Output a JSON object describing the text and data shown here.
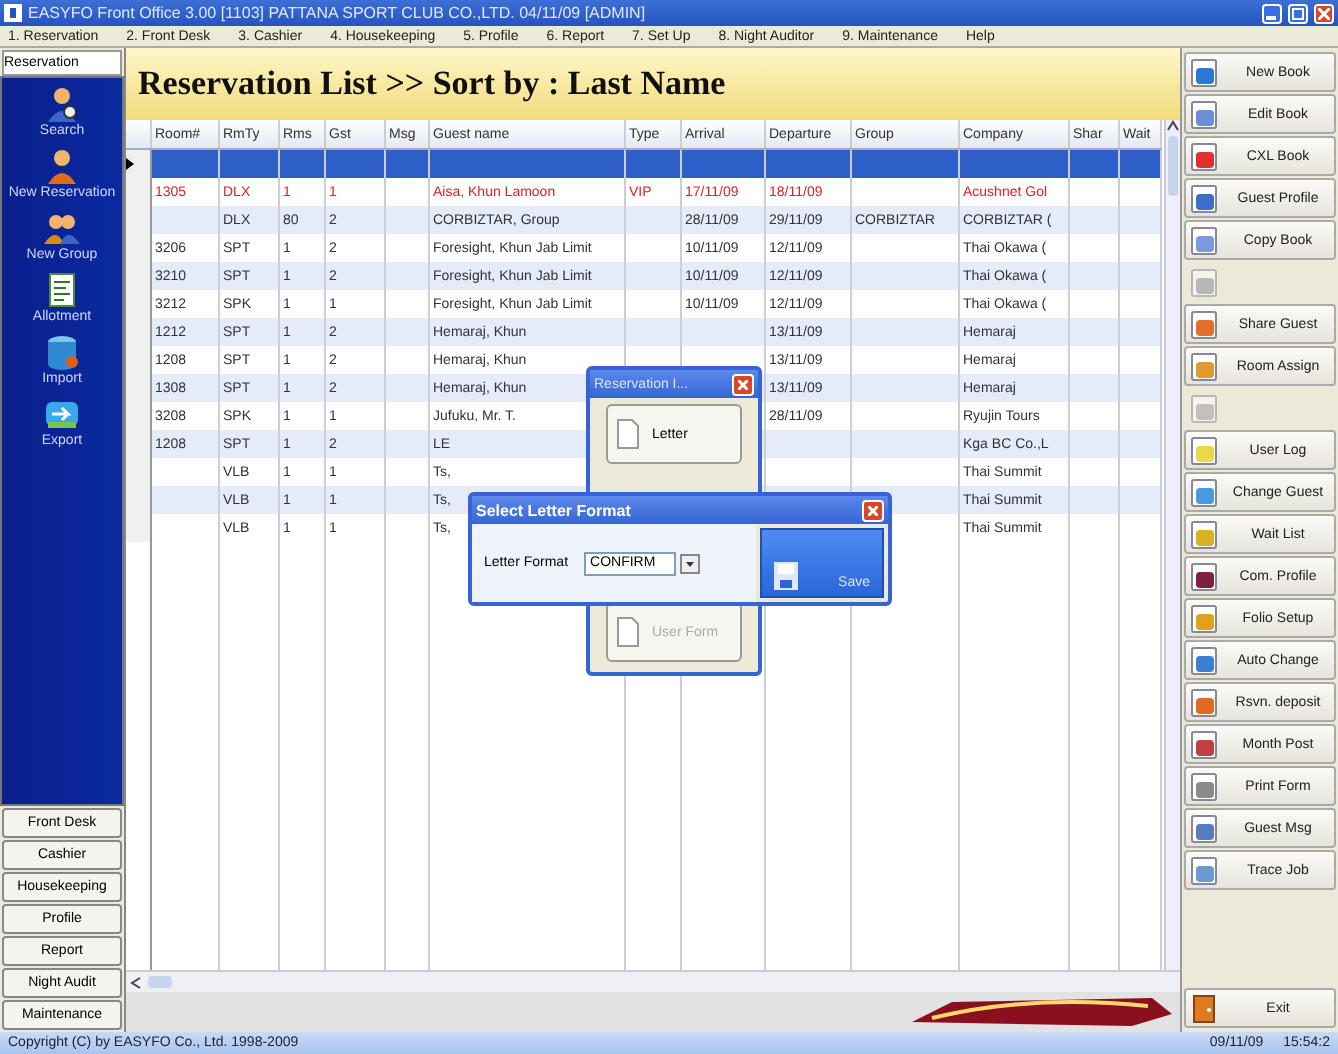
{
  "window": {
    "title": "EASYFO Front Office 3.00 [1103]   PATTANA SPORT CLUB CO.,LTD.  04/11/09 [ADMIN]"
  },
  "menu": [
    "1. Reservation",
    "2. Front Desk",
    "3. Cashier",
    "4. Housekeeping",
    "5. Profile",
    "6. Report",
    "7. Set Up",
    "8. Night Auditor",
    "9. Maintenance",
    "Help"
  ],
  "sidebar": {
    "tab": "Reservation",
    "items": [
      "Search",
      "New Reservation",
      "New Group",
      "Allotment",
      "Import",
      "Export"
    ],
    "modules": [
      "Front Desk",
      "Cashier",
      "Housekeeping",
      "Profile",
      "Report",
      "Night Audit",
      "Maintenance"
    ]
  },
  "heading": "Reservation List >> Sort by : Last Name",
  "table": {
    "columns": [
      "Room#",
      "RmTy",
      "Rms",
      "Gst",
      "Msg",
      "Guest name",
      "Type",
      "Arrival",
      "Departure",
      "Group",
      "Company",
      "Shar",
      "Wait"
    ],
    "rows": [
      {
        "selected": true,
        "alert": false,
        "cells": [
          null,
          null,
          null,
          null,
          null,
          null,
          null,
          null,
          null,
          null,
          null,
          null,
          null
        ]
      },
      {
        "selected": false,
        "alert": true,
        "cells": [
          "1305",
          "DLX",
          "1",
          "1",
          null,
          "Aisa, Khun Lamoon",
          "VIP",
          "17/11/09",
          "18/11/09",
          null,
          "Acushnet Gol",
          null,
          null
        ]
      },
      {
        "selected": false,
        "alert": false,
        "cells": [
          null,
          "DLX",
          "80",
          "2",
          null,
          "CORBIZTAR, Group",
          null,
          "28/11/09",
          "29/11/09",
          "CORBIZTAR",
          "CORBIZTAR (",
          null,
          null
        ]
      },
      {
        "selected": false,
        "alert": false,
        "cells": [
          "3206",
          "SPT",
          "1",
          "2",
          null,
          "Foresight, Khun Jab Limit",
          null,
          "10/11/09",
          "12/11/09",
          null,
          "Thai Okawa (",
          null,
          null
        ]
      },
      {
        "selected": false,
        "alert": false,
        "cells": [
          "3210",
          "SPT",
          "1",
          "2",
          null,
          "Foresight, Khun Jab Limit",
          null,
          "10/11/09",
          "12/11/09",
          null,
          "Thai Okawa (",
          null,
          null
        ]
      },
      {
        "selected": false,
        "alert": false,
        "cells": [
          "3212",
          "SPK",
          "1",
          "1",
          null,
          "Foresight, Khun Jab Limit",
          null,
          "10/11/09",
          "12/11/09",
          null,
          "Thai Okawa (",
          null,
          null
        ]
      },
      {
        "selected": false,
        "alert": false,
        "cells": [
          "1212",
          "SPT",
          "1",
          "2",
          null,
          "Hemaraj, Khun",
          null,
          null,
          "13/11/09",
          null,
          "Hemaraj",
          null,
          null
        ]
      },
      {
        "selected": false,
        "alert": false,
        "cells": [
          "1208",
          "SPT",
          "1",
          "2",
          null,
          "Hemaraj, Khun",
          null,
          null,
          "13/11/09",
          null,
          "Hemaraj",
          null,
          null
        ]
      },
      {
        "selected": false,
        "alert": false,
        "cells": [
          "1308",
          "SPT",
          "1",
          "2",
          null,
          "Hemaraj, Khun",
          null,
          null,
          "13/11/09",
          null,
          "Hemaraj",
          null,
          null
        ]
      },
      {
        "selected": false,
        "alert": false,
        "cells": [
          "3208",
          "SPK",
          "1",
          "1",
          null,
          "Jufuku, Mr. T.",
          null,
          null,
          "28/11/09",
          null,
          "Ryujin Tours",
          null,
          null
        ]
      },
      {
        "selected": false,
        "alert": false,
        "cells": [
          "1208",
          "SPT",
          "1",
          "2",
          null,
          "LE",
          null,
          null,
          null,
          null,
          "Kga BC Co.,L",
          null,
          null
        ]
      },
      {
        "selected": false,
        "alert": false,
        "cells": [
          null,
          "VLB",
          "1",
          "1",
          null,
          "Ts,",
          null,
          null,
          null,
          null,
          "Thai Summit",
          null,
          null
        ]
      },
      {
        "selected": false,
        "alert": false,
        "cells": [
          null,
          "VLB",
          "1",
          "1",
          null,
          "Ts,",
          null,
          null,
          null,
          null,
          "Thai Summit",
          null,
          null
        ]
      },
      {
        "selected": false,
        "alert": false,
        "cells": [
          null,
          "VLB",
          "1",
          "1",
          null,
          "Ts,",
          null,
          null,
          null,
          null,
          "Thai Summit",
          null,
          null
        ]
      }
    ]
  },
  "reservation_dialog": {
    "title": "Reservation I...",
    "buttons": [
      {
        "label": "Letter",
        "disabled": false
      },
      {
        "label": "User Form",
        "disabled": true
      }
    ]
  },
  "letter_dialog": {
    "title": "Select Letter Format",
    "field_label": "Letter Format",
    "value": "CONFIRM",
    "button": "Save"
  },
  "toolbar": [
    {
      "label": "New Book",
      "disabled": false
    },
    {
      "label": "Edit Book",
      "disabled": false
    },
    {
      "label": "CXL Book",
      "disabled": false
    },
    {
      "label": "Guest Profile",
      "disabled": false
    },
    {
      "label": "Copy Book",
      "disabled": false
    },
    {
      "disabled": true
    },
    {
      "label": "Share Guest",
      "disabled": false
    },
    {
      "label": "Room Assign",
      "disabled": false
    },
    {
      "disabled": true
    },
    {
      "label": "User Log",
      "disabled": false
    },
    {
      "label": "Change Guest",
      "disabled": false
    },
    {
      "label": "Wait List",
      "disabled": false
    },
    {
      "label": "Com. Profile",
      "disabled": false
    },
    {
      "label": "Folio Setup",
      "disabled": false
    },
    {
      "label": "Auto Change",
      "disabled": false
    },
    {
      "label": "Rsvn. deposit",
      "disabled": false
    },
    {
      "label": "Month Post",
      "disabled": false
    },
    {
      "label": "Print Form",
      "disabled": false
    },
    {
      "label": "Guest Msg",
      "disabled": false
    },
    {
      "label": "Trace Job",
      "disabled": false
    }
  ],
  "exit_button": "Exit",
  "status_bar": {
    "copyright": "Copyright (C) by EASYFO Co., Ltd. 1998-2009",
    "date": "09/11/09",
    "time": "15:54:2"
  }
}
